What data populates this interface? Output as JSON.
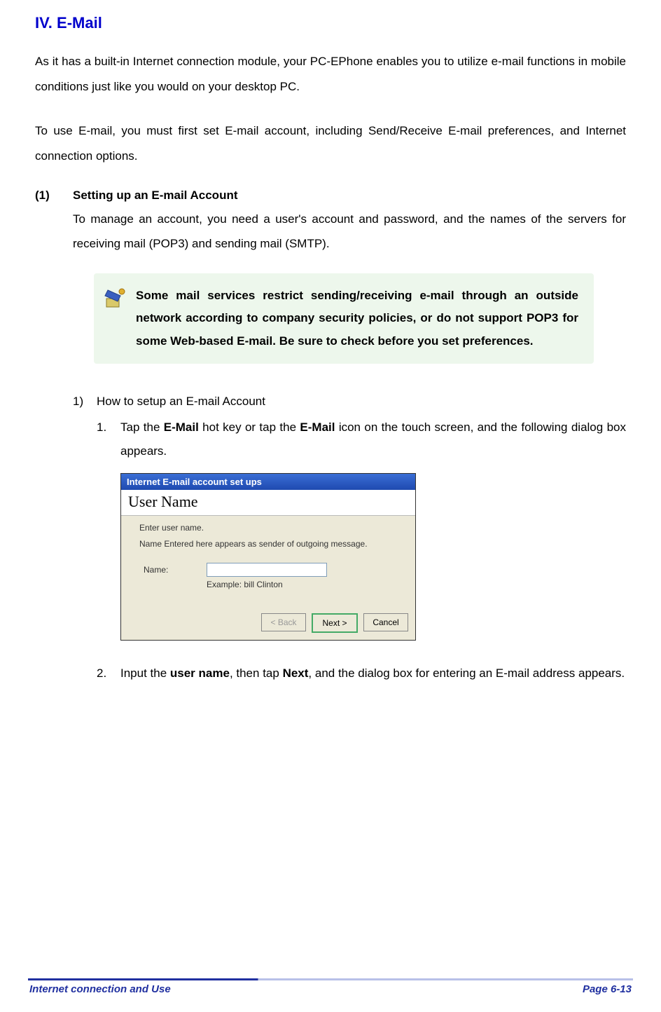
{
  "section": {
    "number": "IV.",
    "title": "E-Mail"
  },
  "intro_p1": "As it has a built-in Internet connection module, your PC-EPhone enables you to utilize e-mail functions in mobile conditions just like you would on your desktop PC.",
  "intro_p2": "To use E-mail, you must first set E-mail account, including Send/Receive E-mail preferences, and Internet connection options.",
  "subsection": {
    "num": "(1)",
    "title": "Setting up an E-mail Account",
    "body": "To manage an account, you need a user's account and password, and the names of the servers for receiving mail (POP3) and sending mail (SMTP)."
  },
  "note": {
    "text": "Some mail services restrict sending/receiving e-mail through an outside network according to company security policies, or do not support POP3 for some Web-based E-mail. Be sure to check before you set preferences."
  },
  "howto": {
    "num": "1)",
    "title": "How to setup an E-mail Account"
  },
  "step1": {
    "num": "1.",
    "pre": "Tap the ",
    "b1": "E-Mail",
    "mid": " hot key or tap the ",
    "b2": "E-Mail",
    "post": " icon on the touch screen, and the following dialog box appears."
  },
  "dialog": {
    "title": "Internet E-mail account set ups",
    "heading": "User Name",
    "line1": "Enter user name.",
    "line2": "Name Entered here appears as sender of outgoing message.",
    "name_label": "Name:",
    "example": "Example: bill Clinton",
    "btn_back": "< Back",
    "btn_next": "Next >",
    "btn_cancel": "Cancel"
  },
  "step2": {
    "num": "2.",
    "pre": "Input the ",
    "b1": "user name",
    "mid": ", then tap ",
    "b2": "Next",
    "post": ", and the dialog box for entering an E-mail address appears."
  },
  "footer": {
    "left": "Internet connection and Use",
    "right": "Page 6-13"
  }
}
